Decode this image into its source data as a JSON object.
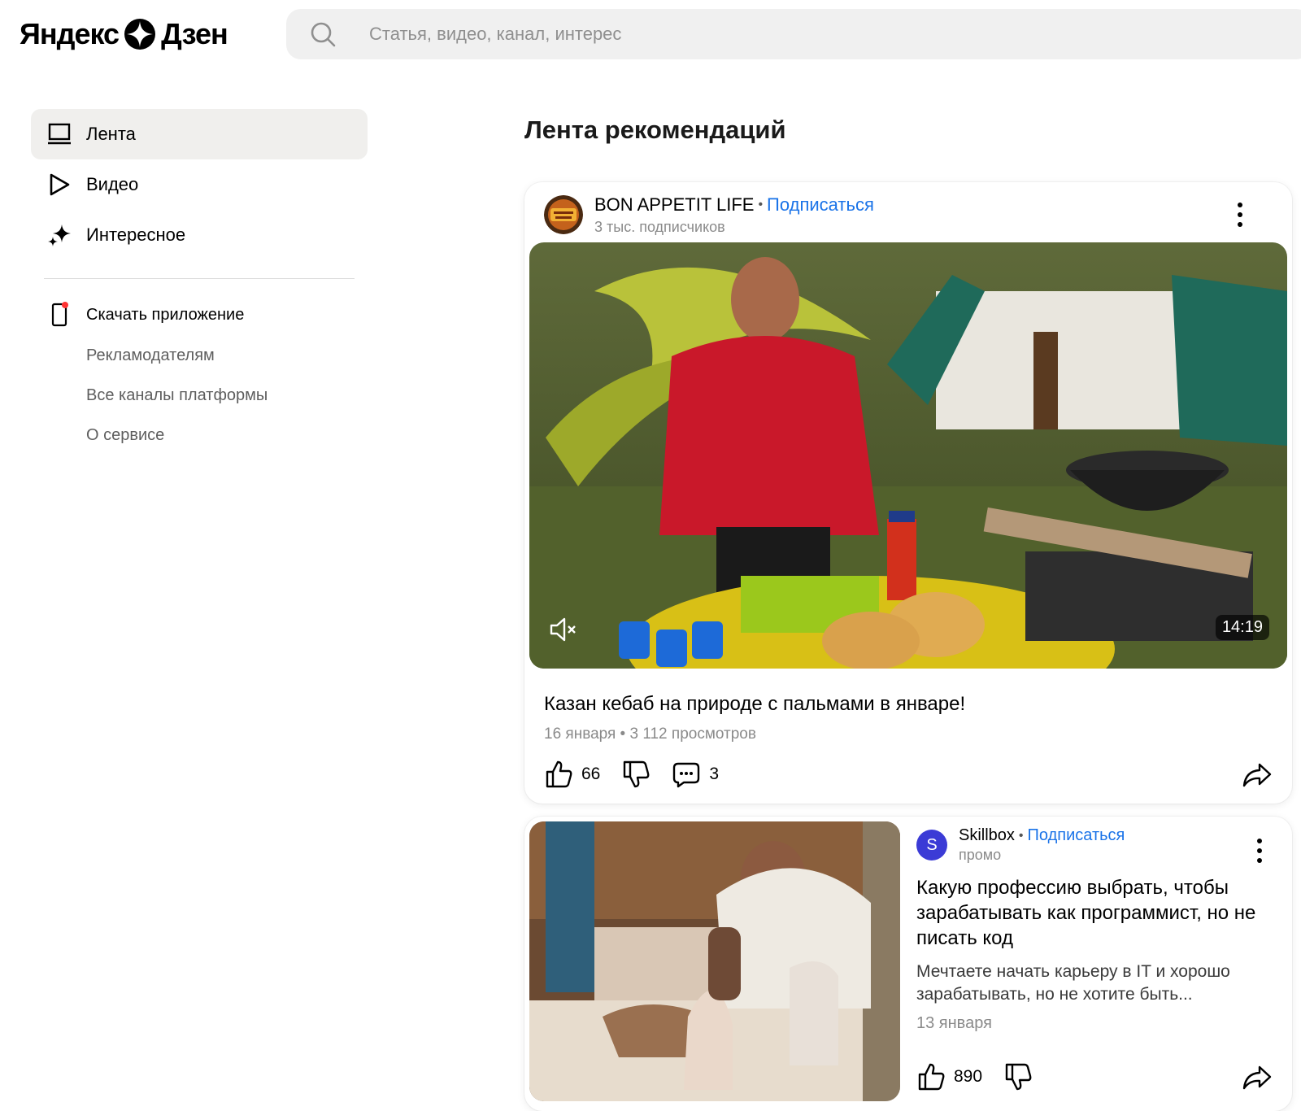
{
  "header": {
    "logo_left": "Яндекс",
    "logo_right": "Дзен",
    "search_placeholder": "Статья, видео, канал, интерес"
  },
  "sidebar": {
    "items": [
      {
        "label": "Лента",
        "icon": "feed-icon",
        "active": true
      },
      {
        "label": "Видео",
        "icon": "play-icon",
        "active": false
      },
      {
        "label": "Интересное",
        "icon": "sparkle-icon",
        "active": false
      }
    ],
    "download_app": "Скачать приложение",
    "links": [
      "Рекламодателям",
      "Все каналы платформы",
      "О сервисе"
    ]
  },
  "main": {
    "title": "Лента рекомендаций",
    "posts": [
      {
        "channel": "BON APPETIT LIFE",
        "subscribe": "Подписаться",
        "subscribers": "3 тыс. подписчиков",
        "duration": "14:19",
        "title": "Казан кебаб на природе с пальмами в январе!",
        "meta": "16 января • 3 112 просмотров",
        "likes": "66",
        "comments": "3"
      },
      {
        "channel": "Skillbox",
        "avatar_letter": "S",
        "subscribe": "Подписаться",
        "label": "промо",
        "title": "Какую профессию выбрать, чтобы зарабатывать как программист, но не писать код",
        "description": "Мечтаете начать карьеру в IT и хорошо зарабатывать, но не хотите быть...",
        "date": "13 января",
        "likes": "890"
      }
    ]
  },
  "colors": {
    "accent": "#1a73e8",
    "active_bg": "#f0efed",
    "search_bg": "#f0f0f0",
    "muted": "#8a8a8a"
  }
}
